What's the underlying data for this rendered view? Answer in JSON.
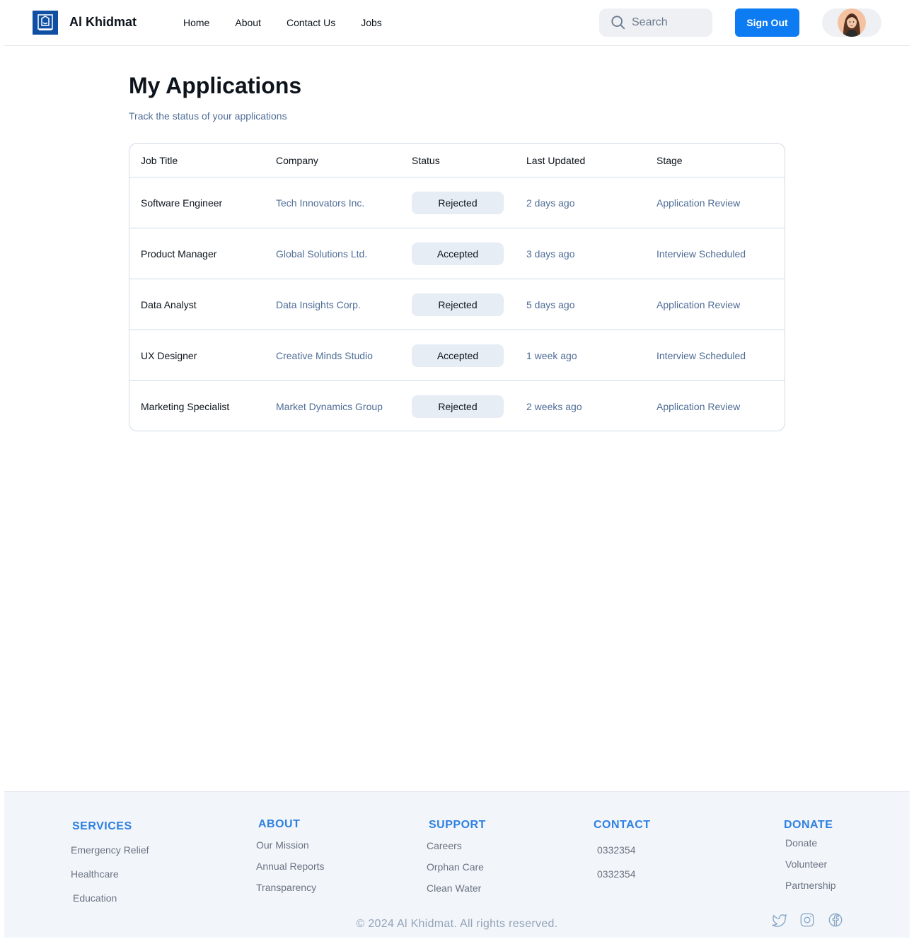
{
  "header": {
    "brand": "Al Khidmat",
    "nav": [
      "Home",
      "About",
      "Contact Us",
      "Jobs"
    ],
    "search_placeholder": "Search",
    "signout_label": "Sign Out",
    "accent_color": "#0d7cf2"
  },
  "main": {
    "title": "My Applications",
    "subtitle": "Track the status of your applications",
    "columns": [
      "Job Title",
      "Company",
      "Status",
      "Last Updated",
      "Stage"
    ],
    "rows": [
      {
        "job": "Software Engineer",
        "company": "Tech Innovators Inc.",
        "status": "Rejected",
        "updated": "2 days ago",
        "stage": "Application Review"
      },
      {
        "job": "Product Manager",
        "company": "Global Solutions Ltd.",
        "status": "Accepted",
        "updated": "3 days ago",
        "stage": "Interview Scheduled"
      },
      {
        "job": "Data Analyst",
        "company": "Data Insights Corp.",
        "status": "Rejected",
        "updated": "5 days ago",
        "stage": "Application Review"
      },
      {
        "job": "UX Designer",
        "company": "Creative Minds Studio",
        "status": "Accepted",
        "updated": "1 week ago",
        "stage": "Interview Scheduled"
      },
      {
        "job": "Marketing Specialist",
        "company": "Market Dynamics Group",
        "status": "Rejected",
        "updated": "2 weeks ago",
        "stage": "Application Review"
      }
    ]
  },
  "footer": {
    "services": {
      "title": "SERVICES",
      "links": [
        "Emergency Relief",
        "Healthcare",
        "Education"
      ]
    },
    "about": {
      "title": "ABOUT",
      "links": [
        "Our Mission",
        "Annual Reports",
        "Transparency"
      ]
    },
    "support": {
      "title": "SUPPORT",
      "links": [
        "Careers",
        "Orphan Care",
        "Clean Water"
      ]
    },
    "contact": {
      "title": "CONTACT",
      "links": [
        "0332354",
        "0332354"
      ]
    },
    "donate": {
      "title": "DONATE",
      "links": [
        "Donate",
        "Volunteer",
        "Partnership"
      ]
    },
    "copyright": "© 2024 Al Khidmat. All rights reserved.",
    "social_icons": [
      "twitter-icon",
      "instagram-icon",
      "facebook-icon"
    ]
  }
}
